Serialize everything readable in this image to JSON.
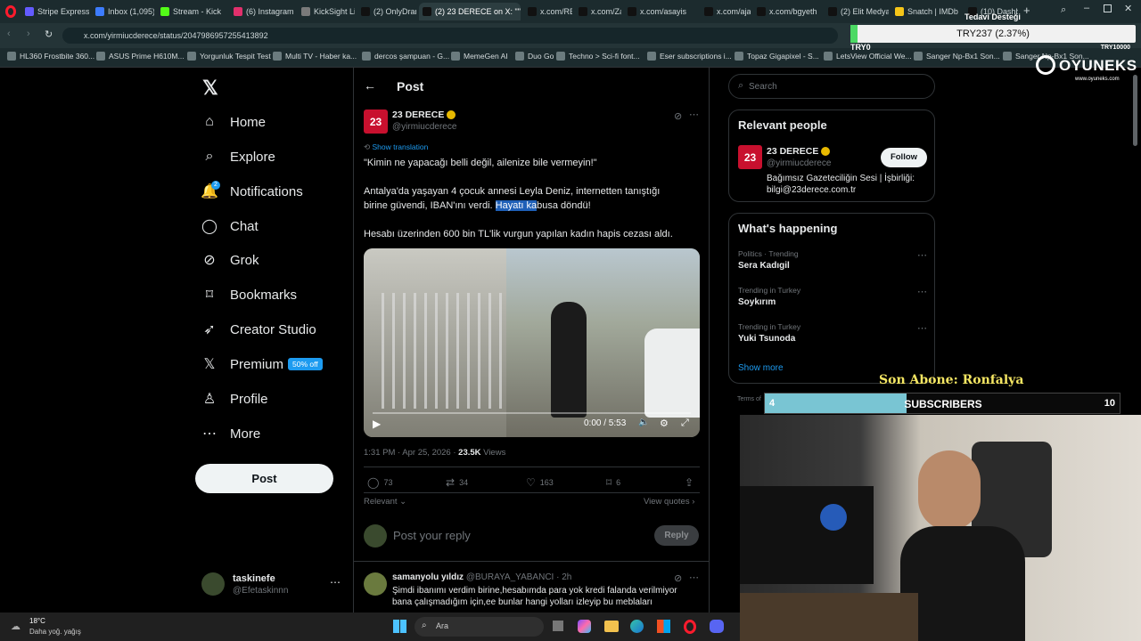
{
  "browser": {
    "tabs": [
      {
        "label": "Stripe Express",
        "color": "#635bff"
      },
      {
        "label": "Inbox (1,095)",
        "color": "#3d7cff"
      },
      {
        "label": "Stream - Kick",
        "color": "#53fc18"
      },
      {
        "label": "(6) Instagram",
        "color": "#e1306c"
      },
      {
        "label": "KickSight Link",
        "color": "#7a7a7a"
      },
      {
        "label": "(2) OnlyDram",
        "color": "#111111"
      },
      {
        "label": "(2) 23 DERECE on X: \"\"",
        "color": "#111111"
      },
      {
        "label": "x.com/REM_",
        "color": "#111111"
      },
      {
        "label": "x.com/ZamHa",
        "color": "#111111"
      },
      {
        "label": "x.com/asayis",
        "color": "#111111"
      },
      {
        "label": "x.com/ajansm",
        "color": "#111111"
      },
      {
        "label": "x.com/bgyeth",
        "color": "#111111"
      },
      {
        "label": "(2) Elit Medya",
        "color": "#111111"
      },
      {
        "label": "Snatch | IMDb",
        "color": "#f5c518"
      },
      {
        "label": "(10) Dashboa",
        "color": "#111111"
      }
    ],
    "new_tab": "+",
    "url": "x.com/yirmiucderece/status/2047986957255413892",
    "bookmarks": [
      "HL360 Frostbite 360...",
      "ASUS Prime H610M...",
      "Yorgunluk Tespit Test",
      "Multi TV - Haber ka...",
      "dercos şampuan - G...",
      "MemeGen AI",
      "Duo Go",
      "Techno > Sci-fi font...",
      "Eser subscriptions i...",
      "Topaz Gigapixel - S...",
      "LetsView Official We...",
      "Sanger Np-Bx1 Son...",
      "Sanger Np-Bx1 Son..."
    ]
  },
  "overlay": {
    "donation_label": "Tedavi Desteği",
    "donation_amount": "TRY237 (2.37%)",
    "donation_min": "TRY0",
    "donation_max": "TRY10000",
    "brand": "OYUNEKS",
    "brand_url": "www.oyuneks.com",
    "last_sub": "Son Abone: Ronfalya",
    "sub_current": "4",
    "sub_label": "SUBSCRIBERS",
    "sub_goal": "10",
    "sub_progress": 0.4
  },
  "nav": {
    "items": [
      {
        "label": "Home",
        "icon": "home-icon",
        "glyph": "⌂"
      },
      {
        "label": "Explore",
        "icon": "search-icon",
        "glyph": "⌕"
      },
      {
        "label": "Notifications",
        "icon": "bell-icon",
        "glyph": "🔔"
      },
      {
        "label": "Chat",
        "icon": "chat-icon",
        "glyph": "◯"
      },
      {
        "label": "Grok",
        "icon": "grok-icon",
        "glyph": "⊘"
      },
      {
        "label": "Bookmarks",
        "icon": "bookmark-icon",
        "glyph": "⌑"
      },
      {
        "label": "Creator Studio",
        "icon": "rocket-icon",
        "glyph": "➶"
      },
      {
        "label": "Premium",
        "icon": "x-logo-icon",
        "glyph": "𝕏"
      },
      {
        "label": "Profile",
        "icon": "person-icon",
        "glyph": "♙"
      },
      {
        "label": "More",
        "icon": "more-icon",
        "glyph": "⋯"
      }
    ],
    "notifications_badge": "2",
    "premium_badge": "50% off",
    "post_button": "Post",
    "user_name": "taskinefe",
    "user_handle": "@Efetaskinnn"
  },
  "post": {
    "header": "Post",
    "author": "23 DERECE",
    "handle": "@yirmiucderece",
    "show_translation": "Show translation",
    "quote": "\"Kimin ne yapacağı belli değil, ailenize bile vermeyin!\"",
    "body_1a": "Antalya'da yaşayan 4 çocuk annesi Leyla Deniz, internetten tanıştığı",
    "body_1b": "birine güvendi, IBAN'ını verdi.",
    "body_1c_selected": "Hayatı ka",
    "body_1d": "busa döndü!",
    "body_2": "Hesabı üzerinden 600 bin TL'lik vurgun yapılan kadın hapis cezası aldı.",
    "video_time": "0:00 / 5:53",
    "timestamp": "1:31 PM · Apr 25, 2026 · ",
    "views_count": "23.5K",
    "views_label": " Views",
    "replies": "73",
    "reposts": "34",
    "likes": "163",
    "bookmarks": "6",
    "relevant": "Relevant",
    "view_quotes": "View quotes",
    "reply_placeholder": "Post your reply",
    "reply_button": "Reply"
  },
  "comment": {
    "author": "samanyolu yıldız",
    "handle": "@BURAYA_YABANCI · 2h",
    "text_1": "Şimdi ibanımı verdim birine,hesabımda para yok kredi falanda verilmiyor",
    "text_2": "bana çalışmadığım için,ee bunlar hangi yolları izleyip bu meblaları"
  },
  "right": {
    "search_placeholder": "Search",
    "relevant_title": "Relevant people",
    "person_name": "23 DERECE",
    "person_handle": "@yirmiucderece",
    "person_bio_1": "Bağımsız Gazeteciliğin Sesi | İşbirliği:",
    "person_bio_2": "bilgi@23derece.com.tr",
    "follow": "Follow",
    "happening_title": "What's happening",
    "trends": [
      {
        "category": "Politics · Trending",
        "name": "Sera Kadıgil"
      },
      {
        "category": "Trending in Turkey",
        "name": "Soykırım"
      },
      {
        "category": "Trending in Turkey",
        "name": "Yuki Tsunoda"
      }
    ],
    "show_more": "Show more",
    "terms": "Terms of"
  },
  "taskbar": {
    "temp": "18°C",
    "weather": "Daha yoğ. yağış",
    "search": "Ara"
  }
}
